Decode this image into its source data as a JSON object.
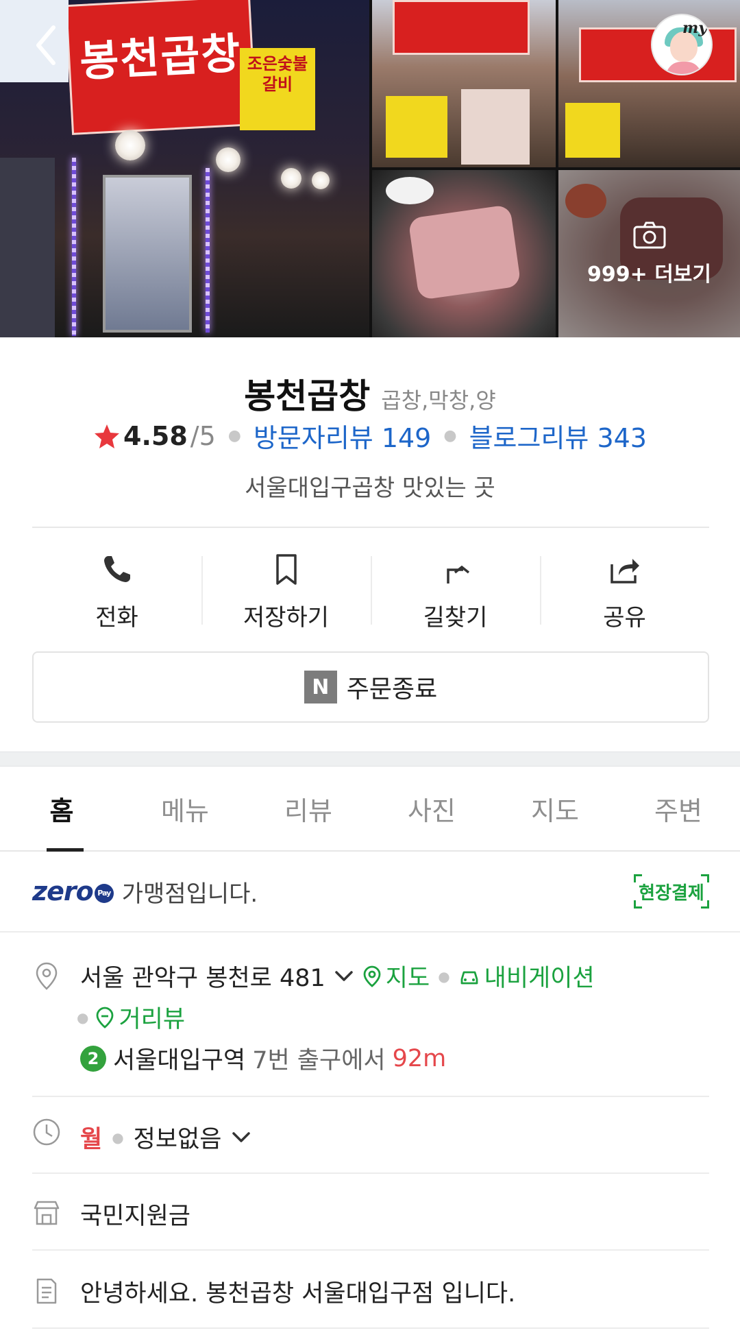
{
  "gallery": {
    "main_sign": "봉천곱창",
    "side_sign": "조은숯불갈비",
    "more_label": "999+ 더보기",
    "my_label": "my"
  },
  "place": {
    "name": "봉천곱창",
    "category": "곱창,막창,양",
    "rating": "4.58",
    "rating_max": "/5",
    "visitor_reviews": "방문자리뷰 149",
    "blog_reviews": "블로그리뷰 343",
    "tagline": "서울대입구곱창 맛있는 곳"
  },
  "actions": [
    {
      "label": "전화",
      "icon": "phone-icon"
    },
    {
      "label": "저장하기",
      "icon": "bookmark-icon"
    },
    {
      "label": "길찾기",
      "icon": "directions-icon"
    },
    {
      "label": "공유",
      "icon": "share-icon"
    }
  ],
  "order": {
    "badge": "N",
    "label": "주문종료"
  },
  "tabs": [
    "홈",
    "메뉴",
    "리뷰",
    "사진",
    "지도",
    "주변"
  ],
  "zeropay": {
    "logo": "zero",
    "logo_sub": "Pay",
    "text": "가맹점입니다.",
    "onsite": "현장결제"
  },
  "address": {
    "text": "서울 관악구 봉천로 481",
    "map_link": "지도",
    "nav_link": "내비게이션",
    "street_link": "거리뷰",
    "subway_line": "2",
    "station": "서울대입구역",
    "exit": "7번 출구에서",
    "distance": "92m"
  },
  "hours": {
    "day": "월",
    "status": "정보없음"
  },
  "support": "국민지원금",
  "intro": "안녕하세요. 봉천곱창 서울대입구점 입니다.",
  "colors": {
    "accent_green": "#1ba23f",
    "link_blue": "#1d66c9",
    "star_red": "#e8383d",
    "distance_red": "#e5474b",
    "line2_green": "#33a23d"
  }
}
